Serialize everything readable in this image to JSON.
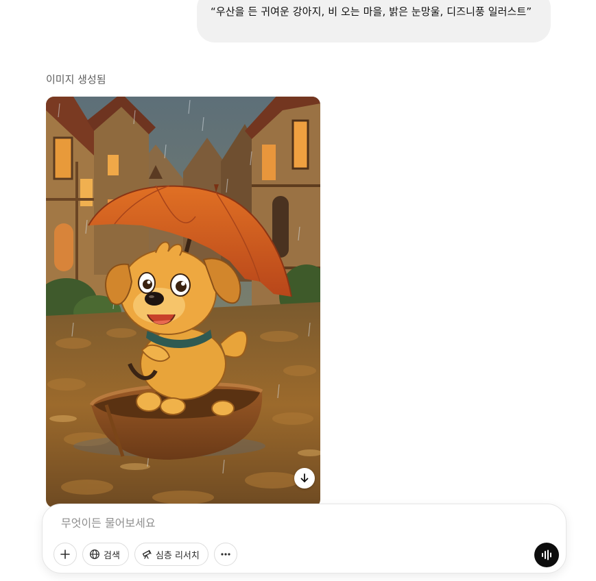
{
  "conversation": {
    "user_prompt": "“우산을 든 귀여운 강아지, 비 오는 마을, 밝은 눈망울, 디즈니풍 일러스트”",
    "image_status_label": "이미지 생성됨"
  },
  "image": {
    "alt": "우산을 든 귀여운 강아지, 비 오는 마을, 밝은 눈망울, 디즈니풍 일러스트",
    "download_icon": "arrow-down-icon"
  },
  "composer": {
    "placeholder": "무엇이든 물어보세요",
    "value": "",
    "tools": {
      "add_icon": "plus-icon",
      "search_label": "검색",
      "search_icon": "globe-icon",
      "research_label": "심층 리서치",
      "research_icon": "telescope-icon",
      "more_icon": "ellipsis-icon"
    },
    "voice_icon": "waveform-icon"
  },
  "colors": {
    "bubble_bg": "#f1f1f1",
    "voice_button": "#0d0d0d",
    "umbrella": "#d8621e",
    "puppy": "#e8a43a"
  }
}
